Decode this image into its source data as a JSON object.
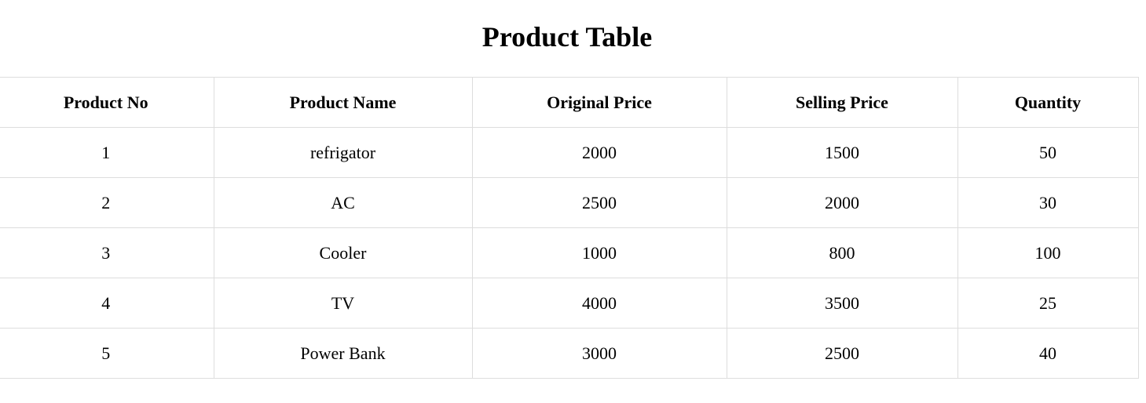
{
  "page": {
    "title": "Product Table"
  },
  "table": {
    "headers": [
      "Product No",
      "Product Name",
      "Original Price",
      "Selling Price",
      "Quantity"
    ],
    "rows": [
      [
        "1",
        "refrigator",
        "2000",
        "1500",
        "50"
      ],
      [
        "2",
        "AC",
        "2500",
        "2000",
        "30"
      ],
      [
        "3",
        "Cooler",
        "1000",
        "800",
        "100"
      ],
      [
        "4",
        "TV",
        "4000",
        "3500",
        "25"
      ],
      [
        "5",
        "Power Bank",
        "3000",
        "2500",
        "40"
      ]
    ]
  },
  "colors": {
    "border": "#dddddd",
    "text": "#000000",
    "background": "#ffffff"
  }
}
